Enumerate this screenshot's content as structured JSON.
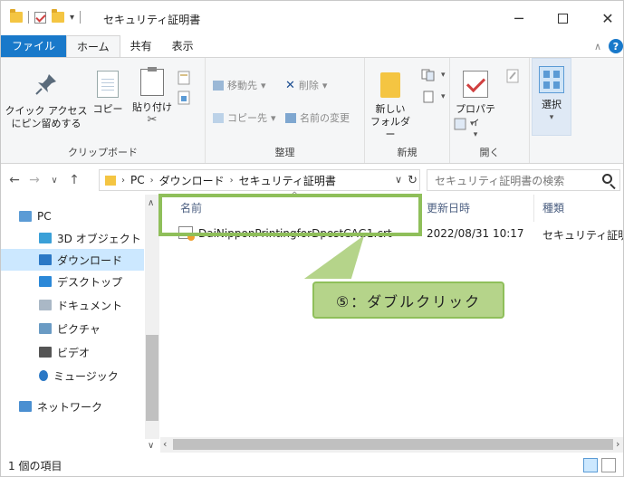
{
  "window": {
    "title": "セキュリティ証明書"
  },
  "ribbon_tabs": [
    "ファイル",
    "ホーム",
    "共有",
    "表示"
  ],
  "ribbon": {
    "clipboard": {
      "pin_label_1": "クイック アクセス",
      "pin_label_2": "にピン留めする",
      "copy": "コピー",
      "paste": "貼り付け",
      "group": "クリップボード"
    },
    "organize": {
      "move_to": "移動先",
      "delete": "削除",
      "copy_to": "コピー先",
      "rename": "名前の変更",
      "group": "整理"
    },
    "new": {
      "new_folder_1": "新しい",
      "new_folder_2": "フォルダー",
      "group": "新規"
    },
    "open": {
      "properties": "プロパティ",
      "group": "開く"
    },
    "select": {
      "label": "選択"
    }
  },
  "address": {
    "path": [
      "PC",
      "ダウンロード",
      "セキュリティ証明書"
    ],
    "search_placeholder": "セキュリティ証明書の検索"
  },
  "nav_items": [
    {
      "label": "PC",
      "icon": "pc-icon",
      "color": "#5b9bd5"
    },
    {
      "label": "3D オブジェクト",
      "icon": "3d-objects-icon",
      "color": "#3aa0d8"
    },
    {
      "label": "ダウンロード",
      "icon": "download-icon",
      "color": "#2b78c5"
    },
    {
      "label": "デスクトップ",
      "icon": "desktop-icon",
      "color": "#2b88d8"
    },
    {
      "label": "ドキュメント",
      "icon": "document-icon",
      "color": "#aab8c6"
    },
    {
      "label": "ピクチャ",
      "icon": "pictures-icon",
      "color": "#6a9bc4"
    },
    {
      "label": "ビデオ",
      "icon": "video-icon",
      "color": "#555"
    },
    {
      "label": "ミュージック",
      "icon": "music-icon",
      "color": "#2b78c5"
    },
    {
      "label": "ネットワーク",
      "icon": "network-icon",
      "color": "#4a8fd1"
    }
  ],
  "columns": {
    "name": "名前",
    "modified": "更新日時",
    "type": "種類"
  },
  "files": [
    {
      "name": "DaiNipponPrintingforDpostCAG1.crt",
      "modified": "2022/08/31 10:17",
      "type": "セキュリティ証明書"
    }
  ],
  "annotation": {
    "text": "⑤：ダブルクリック",
    "color": "#b5d48a"
  },
  "status": {
    "count": "1 個の項目"
  }
}
